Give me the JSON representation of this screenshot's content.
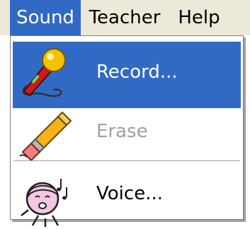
{
  "menubar": {
    "items": [
      {
        "label": "Sound",
        "active": true
      },
      {
        "label": "Teacher",
        "active": false
      },
      {
        "label": "Help",
        "active": false
      }
    ]
  },
  "dropdown": {
    "items": [
      {
        "label": "Record...",
        "icon": "microphone-icon",
        "state": "highlighted"
      },
      {
        "label": "Erase",
        "icon": "pencil-eraser-icon",
        "state": "disabled"
      },
      {
        "label": "Voice...",
        "icon": "singing-face-icon",
        "state": "normal"
      }
    ]
  },
  "colors": {
    "highlight": "#316ac5",
    "menubar_bg": "#ece9d8",
    "disabled_text": "#a0a0a0"
  }
}
